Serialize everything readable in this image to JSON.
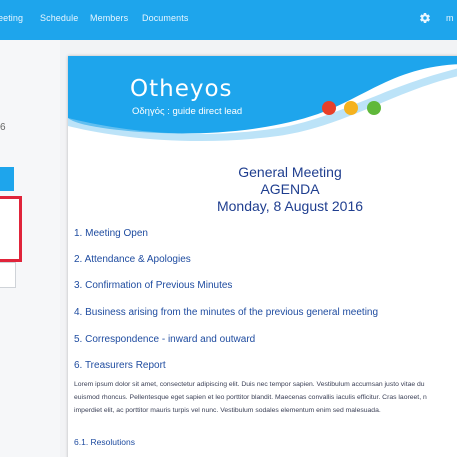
{
  "nav": {
    "items": [
      {
        "label": "eeting"
      },
      {
        "label": "Schedule"
      },
      {
        "label": "Members"
      },
      {
        "label": "Documents"
      }
    ],
    "user_label": "m"
  },
  "left": {
    "number_text": "6"
  },
  "doc": {
    "brand": {
      "name": "Otheyos",
      "tagline": "Οδηγός : guide direct lead"
    },
    "dot_colors": [
      "#e8402a",
      "#f5b21f",
      "#5fb83a"
    ],
    "title_lines": [
      "General Meeting",
      "AGENDA",
      "Monday, 8 August 2016"
    ],
    "agenda_items": [
      "1. Meeting Open",
      "2. Attendance & Apologies",
      "3. Confirmation of Previous Minutes",
      "4. Business arising from the minutes of the previous general meeting",
      "5. Correspondence - inward and outward",
      "6. Treasurers Report"
    ],
    "lorem_lines": [
      "Lorem ipsum dolor sit amet, consectetur adipiscing elit. Duis nec tempor sapien. Vestibulum accumsan justo vitae du",
      "euismod rhoncus. Pellentesque eget sapien et leo porttitor blandit. Maecenas convallis iaculis efficitur. Cras laoreet, n",
      "imperdiet elit, ac porttitor mauris turpis vel nunc. Vestibulum sodales elementum enim sed malesuada."
    ],
    "subitem": "6.1. Resolutions"
  },
  "colors": {
    "nav_bg": "#1ea5ec",
    "accent_red": "#e0243a",
    "heading_blue": "#1f3e8f"
  }
}
